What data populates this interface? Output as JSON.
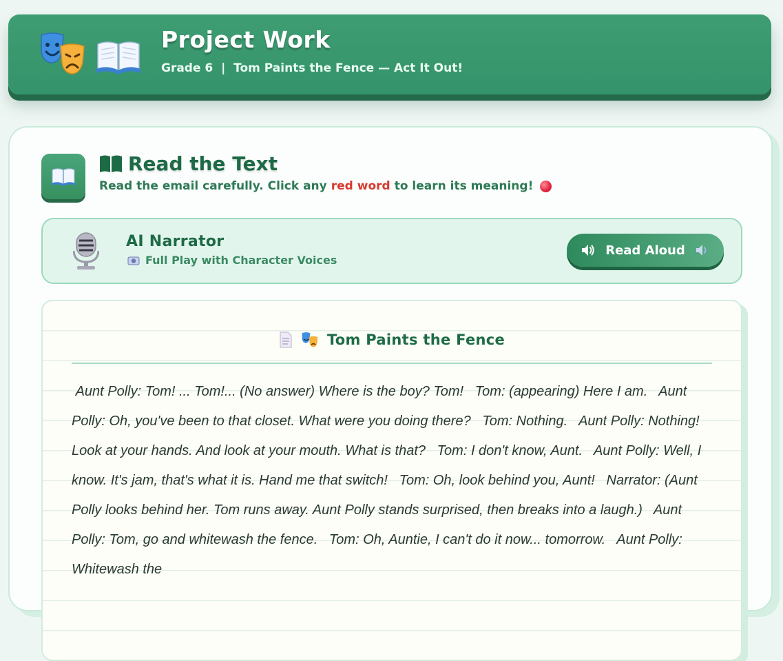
{
  "header": {
    "title": "Project Work",
    "subtitle": "Grade 6  |  Tom Paints the Fence — Act It Out!",
    "icons": [
      "theater-masks-icon",
      "open-book-icon"
    ]
  },
  "section": {
    "title": "Read the Text",
    "subtitle_before": "Read the email carefully. Click any",
    "subtitle_red": "red word",
    "subtitle_after": "to learn its meaning!"
  },
  "narrator": {
    "title": "AI Narrator",
    "subtitle": "Full Play with Character Voices",
    "button_label": "Read Aloud"
  },
  "story": {
    "title": "Tom Paints the Fence",
    "text": " Aunt Polly: Tom! ... Tom!... (No answer) Where is the boy? Tom!   Tom: (appearing) Here I am.   Aunt Polly: Oh, you've been to that closet. What were you doing there?   Tom: Nothing.   Aunt Polly: Nothing! Look at your hands. And look at your mouth. What is that?   Tom: I don't know, Aunt.   Aunt Polly: Well, I know. It's jam, that's what it is. Hand me that switch!   Tom: Oh, look behind you, Aunt!   Narrator: (Aunt Polly looks behind her. Tom runs away. Aunt Polly stands surprised, then breaks into a laugh.)   Aunt Polly: Tom, go and whitewash the fence.   Tom: Oh, Auntie, I can't do it now... tomorrow.   Aunt Polly: Whitewash the"
  },
  "colors": {
    "accent": "#3a9a6e",
    "dark_accent": "#1d6b46",
    "highlight_red": "#d63a2f"
  }
}
